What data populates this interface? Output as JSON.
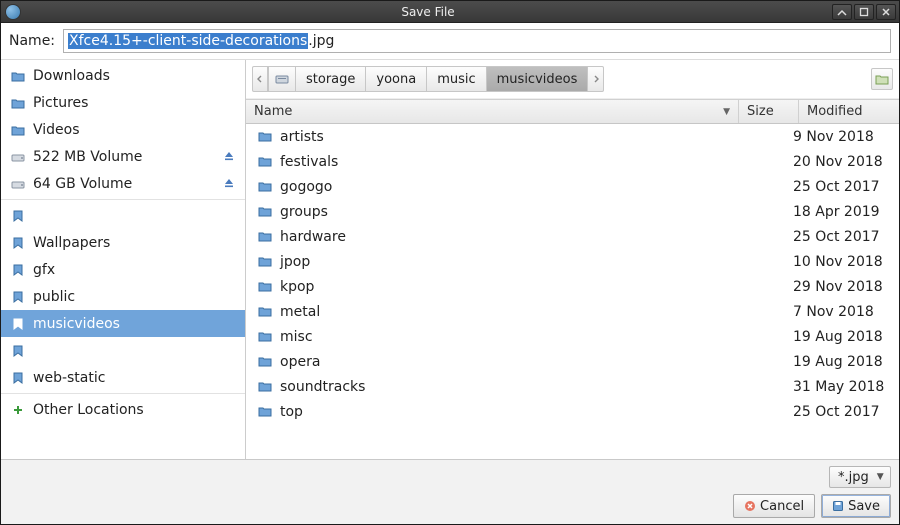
{
  "window": {
    "title": "Save File"
  },
  "name_field": {
    "label": "Name:",
    "selected": "Xfce4.15+-client-side-decorations",
    "rest": ".jpg"
  },
  "sidebar": {
    "items": [
      {
        "label": "Downloads",
        "icon": "folder",
        "eject": false
      },
      {
        "label": "Pictures",
        "icon": "folder",
        "eject": false
      },
      {
        "label": "Videos",
        "icon": "folder",
        "eject": false
      },
      {
        "label": "522 MB Volume",
        "icon": "drive",
        "eject": true
      },
      {
        "label": "64 GB Volume",
        "icon": "drive",
        "eject": true
      }
    ],
    "bookmarks": [
      {
        "label": "",
        "icon": "bookmark"
      },
      {
        "label": "Wallpapers",
        "icon": "bookmark"
      },
      {
        "label": "gfx",
        "icon": "bookmark"
      },
      {
        "label": "public",
        "icon": "bookmark"
      },
      {
        "label": "musicvideos",
        "icon": "bookmark",
        "selected": true
      },
      {
        "label": "",
        "icon": "bookmark"
      },
      {
        "label": "web-static",
        "icon": "bookmark"
      }
    ],
    "other": {
      "label": "Other Locations"
    }
  },
  "path": {
    "segments": [
      "storage",
      "yoona",
      "music",
      "musicvideos"
    ],
    "active_index": 3
  },
  "columns": {
    "name": "Name",
    "size": "Size",
    "modified": "Modified"
  },
  "files": [
    {
      "name": "artists",
      "size": "",
      "modified": "9 Nov 2018"
    },
    {
      "name": "festivals",
      "size": "",
      "modified": "20 Nov 2018"
    },
    {
      "name": "gogogo",
      "size": "",
      "modified": "25 Oct 2017"
    },
    {
      "name": "groups",
      "size": "",
      "modified": "18 Apr 2019"
    },
    {
      "name": "hardware",
      "size": "",
      "modified": "25 Oct 2017"
    },
    {
      "name": "jpop",
      "size": "",
      "modified": "10 Nov 2018"
    },
    {
      "name": "kpop",
      "size": "",
      "modified": "29 Nov 2018"
    },
    {
      "name": "metal",
      "size": "",
      "modified": "7 Nov 2018"
    },
    {
      "name": "misc",
      "size": "",
      "modified": "19 Aug 2018"
    },
    {
      "name": "opera",
      "size": "",
      "modified": "19 Aug 2018"
    },
    {
      "name": "soundtracks",
      "size": "",
      "modified": "31 May 2018"
    },
    {
      "name": "top",
      "size": "",
      "modified": "25 Oct 2017"
    }
  ],
  "filter": {
    "value": "*.jpg"
  },
  "buttons": {
    "cancel": "Cancel",
    "save": "Save"
  }
}
